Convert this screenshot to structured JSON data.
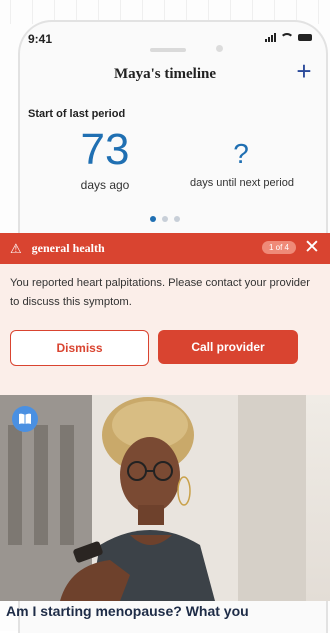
{
  "status_bar": {
    "time": "9:41"
  },
  "header": {
    "title": "Maya's timeline",
    "add_label": "+"
  },
  "stats": {
    "section_label": "Start of last period",
    "days_ago_value": "73",
    "days_ago_label": "days ago",
    "until_next_value": "?",
    "until_next_label": "days until next period"
  },
  "carousel": {
    "page_count": 3,
    "active_index": 0
  },
  "alert": {
    "title": "general health",
    "counter": "1 of 4",
    "close_label": "✕",
    "message": "You reported heart palpitations. Please contact your provider to discuss this symptom.",
    "dismiss_label": "Dismiss",
    "call_label": "Call provider"
  },
  "article": {
    "title": "Am I starting menopause?  What you",
    "badge_icon": "book-icon"
  },
  "colors": {
    "accent_blue": "#1f6fb2",
    "alert_red": "#d94430",
    "alert_body": "#fbeee9"
  }
}
